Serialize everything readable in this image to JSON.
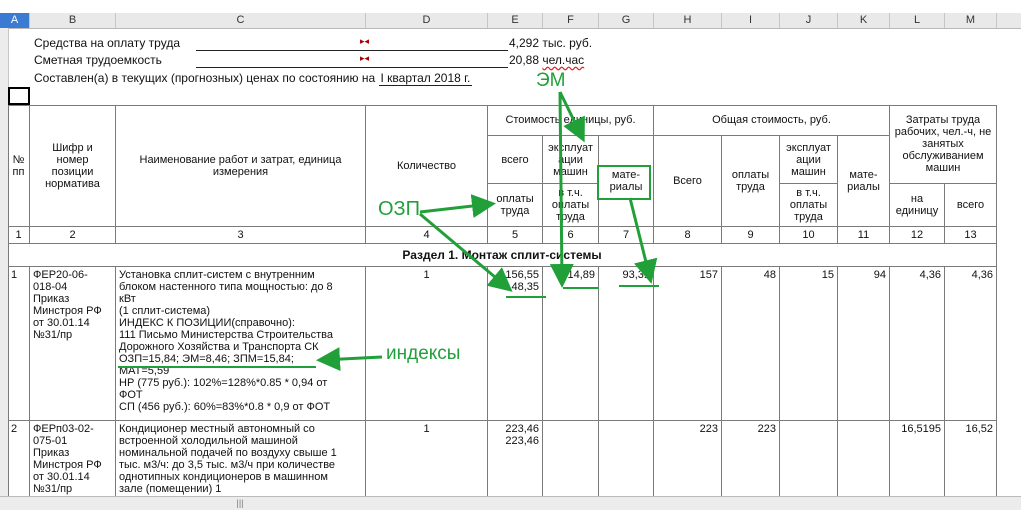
{
  "columns": [
    "A",
    "B",
    "C",
    "D",
    "E",
    "F",
    "G",
    "H",
    "I",
    "J",
    "K",
    "L",
    "M"
  ],
  "info": {
    "labor_fund_label": "Средства на оплату труда",
    "labor_fund_value": "4,292",
    "labor_fund_unit": "тыс. руб.",
    "labor_intensity_label": "Сметная трудоемкость",
    "labor_intensity_value": "20,88",
    "labor_intensity_unit": "чел.час",
    "compiled_text": "Составлен(а) в текущих (прогнозных) ценах по состоянию на",
    "compiled_period": "I квартал 2018 г."
  },
  "header": {
    "no": "№\nпп",
    "code": "Шифр и\nномер\nпозиции\nнорматива",
    "name": "Наименование работ и затрат, единица\nизмерения",
    "qty": "Количество",
    "unit_cost": "Стоимость единицы, руб.",
    "total_cost": "Общая стоимость, руб.",
    "labor": "Затраты труда\nрабочих, чел.-ч, не\nзанятых\nобслуживанием\nмашин",
    "uc_all": "всего",
    "uc_machines": "эксплуат\nации\nмашин",
    "uc_materials": "мате-\nриалы",
    "uc_wages": "оплаты\nтруда",
    "uc_machines_wages": "в т.ч.\nоплаты\nтруда",
    "tc_all": "Всего",
    "tc_wages": "оплаты\nтруда",
    "tc_machines": "эксплуат\nации\nмашин",
    "tc_machines_wages": "в т.ч.\nоплаты\nтруда",
    "tc_materials": "мате-\nриалы",
    "labor_unit": "на\nединицу",
    "labor_total": "всего"
  },
  "col_numbers": [
    "1",
    "2",
    "3",
    "4",
    "5",
    "6",
    "7",
    "8",
    "9",
    "10",
    "11",
    "12",
    "13"
  ],
  "section_title": "Раздел 1. Монтаж сплит-системы",
  "rows": [
    {
      "no": "1",
      "code": "ФЕР20-06-\n018-04\nПриказ\nМинстроя РФ\nот 30.01.14\n№31/пр",
      "name": "Установка сплит-систем с внутренним\nблоком настенного типа мощностью: до 8\nкВт\n(1 сплит-система)\nИНДЕКС К ПОЗИЦИИ(справочно):\n111 Письмо Министерства Строительства\nДорожного Хозяйства и Транспорта СК\nОЗП=15,84; ЭМ=8,46; ЗПМ=15,84;\nМАТ=5,59\nНР (775 руб.): 102%=128%*0.85 * 0,94 от\nФОТ\nСП (456 руб.): 60%=83%*0.8 * 0,9 от ФОТ",
      "qty": "1",
      "uc_all": "156,55",
      "uc_wages": "48,35",
      "uc_machines": "14,89",
      "uc_materials": "93,31",
      "tc_all": "157",
      "tc_wages": "48",
      "tc_machines": "15",
      "tc_materials": "94",
      "labor_unit": "4,36",
      "labor_total": "4,36"
    },
    {
      "no": "2",
      "code": "ФЕРп03-02-\n075-01\nПриказ\nМинстроя РФ\nот 30.01.14\n№31/пр",
      "name": "Кондиционер местный автономный со\nвстроенной холодильной машиной\nноминальной подачей по воздуху свыше 1\nтыс. м3/ч: до 3,5 тыс. м3/ч при количестве\nоднотипных кондиционеров в машинном\nзале (помещении) 1",
      "qty": "1",
      "uc_all": "223,46",
      "uc_wages": "223,46",
      "tc_all": "223",
      "tc_wages": "223",
      "labor_unit": "16,5195",
      "labor_total": "16,52"
    }
  ],
  "annotations": {
    "em": "ЭМ",
    "ozp": "ОЗП",
    "indexes": "индексы"
  },
  "scroll_thumb": "|||",
  "colors": {
    "annotation": "#21a03a",
    "selected_col": "#3b7bd4"
  }
}
